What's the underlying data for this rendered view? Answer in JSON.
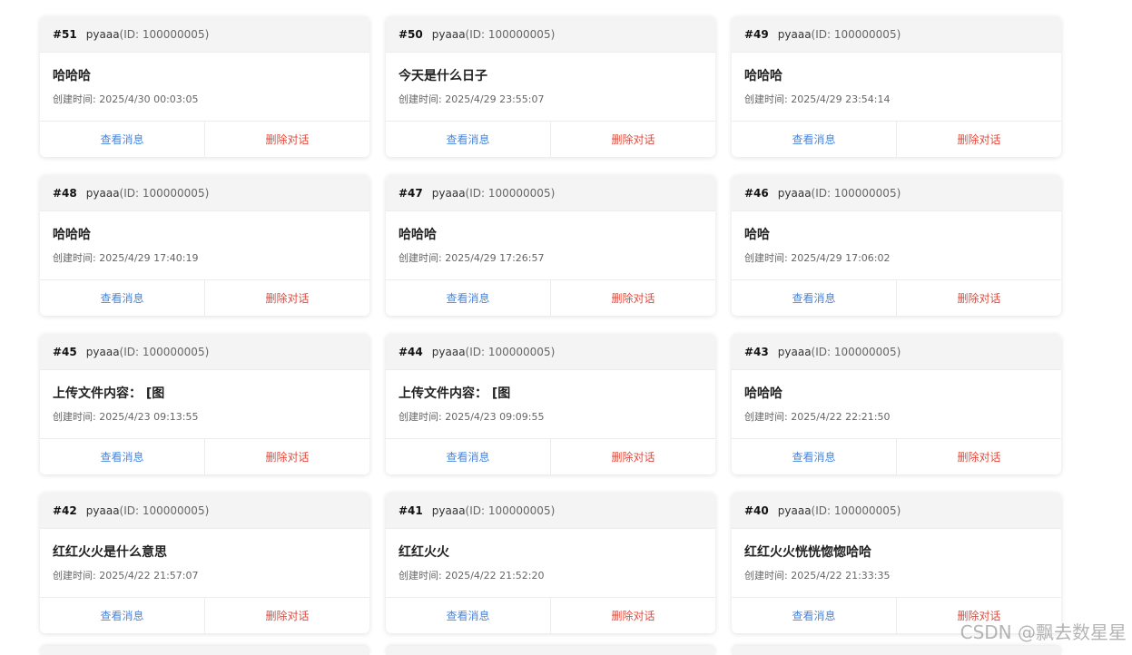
{
  "labels": {
    "created_prefix": "创建时间: ",
    "view_label": "查看消息",
    "delete_label": "删除对话"
  },
  "colors": {
    "view": "#4a86d8",
    "delete": "#e04a3c",
    "header_bg": "#f4f4f4"
  },
  "conversations": [
    {
      "num": "#51",
      "user": "pyaaa",
      "uid": "(ID: 100000005)",
      "title": "哈哈哈",
      "time": "2025/4/30 00:03:05"
    },
    {
      "num": "#50",
      "user": "pyaaa",
      "uid": "(ID: 100000005)",
      "title": "今天是什么日子",
      "time": "2025/4/29 23:55:07"
    },
    {
      "num": "#49",
      "user": "pyaaa",
      "uid": "(ID: 100000005)",
      "title": "哈哈哈",
      "time": "2025/4/29 23:54:14"
    },
    {
      "num": "#48",
      "user": "pyaaa",
      "uid": "(ID: 100000005)",
      "title": "哈哈哈",
      "time": "2025/4/29 17:40:19"
    },
    {
      "num": "#47",
      "user": "pyaaa",
      "uid": "(ID: 100000005)",
      "title": "哈哈哈",
      "time": "2025/4/29 17:26:57"
    },
    {
      "num": "#46",
      "user": "pyaaa",
      "uid": "(ID: 100000005)",
      "title": "哈哈",
      "time": "2025/4/29 17:06:02"
    },
    {
      "num": "#45",
      "user": "pyaaa",
      "uid": "(ID: 100000005)",
      "title": "上传文件内容： [图",
      "time": "2025/4/23 09:13:55"
    },
    {
      "num": "#44",
      "user": "pyaaa",
      "uid": "(ID: 100000005)",
      "title": "上传文件内容： [图",
      "time": "2025/4/23 09:09:55"
    },
    {
      "num": "#43",
      "user": "pyaaa",
      "uid": "(ID: 100000005)",
      "title": "哈哈哈",
      "time": "2025/4/22 22:21:50"
    },
    {
      "num": "#42",
      "user": "pyaaa",
      "uid": "(ID: 100000005)",
      "title": "红红火火是什么意思",
      "time": "2025/4/22 21:57:07"
    },
    {
      "num": "#41",
      "user": "pyaaa",
      "uid": "(ID: 100000005)",
      "title": "红红火火",
      "time": "2025/4/22 21:52:20"
    },
    {
      "num": "#40",
      "user": "pyaaa",
      "uid": "(ID: 100000005)",
      "title": "红红火火恍恍惚惚哈哈",
      "time": "2025/4/22 21:33:35"
    }
  ],
  "watermark": "CSDN @飘去数星星"
}
